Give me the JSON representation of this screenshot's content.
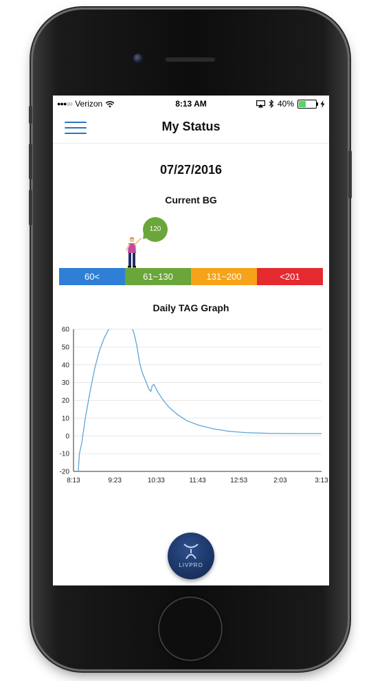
{
  "status_bar": {
    "signal_dots": "●●●○○",
    "carrier": "Verizon",
    "time": "8:13 AM",
    "battery_percent": "40%",
    "battery_level": 0.4
  },
  "nav": {
    "title": "My Status",
    "menu_icon": "hamburger-menu-icon"
  },
  "date": "07/27/2016",
  "current_bg": {
    "title": "Current BG",
    "value": "120",
    "ranges": [
      {
        "label": "60<",
        "color": "#2f7fd6"
      },
      {
        "label": "61~130",
        "color": "#6aa63a"
      },
      {
        "label": "131~200",
        "color": "#f6a31a"
      },
      {
        "label": "<201",
        "color": "#e52a30"
      }
    ]
  },
  "graph_title": "Daily TAG Graph",
  "chart_data": {
    "type": "line",
    "title": "Daily TAG Graph",
    "xlabel": "",
    "ylabel": "",
    "x_ticks": [
      "8:13",
      "9:23",
      "10:33",
      "11:43",
      "12:53",
      "2:03",
      "3:13"
    ],
    "y_ticks": [
      60,
      50,
      40,
      30,
      20,
      10,
      0,
      -10,
      -20
    ],
    "ylim": [
      -20,
      60
    ],
    "xlim_minutes": [
      0,
      420
    ],
    "grid": true,
    "line_color": "#5aa6d6",
    "series": [
      {
        "segments": [
          {
            "x": [
              8,
              10,
              14,
              20,
              28,
              36,
              44,
              52,
              58,
              60
            ],
            "y": [
              -20,
              -10,
              -4,
              10,
              25,
              38,
              48,
              55,
              59,
              60
            ]
          },
          {
            "x": [
              100,
              103,
              107,
              112,
              116,
              122,
              128,
              131,
              133,
              136,
              139,
              144,
              152,
              162,
              176,
              192,
              212,
              236,
              262,
              292,
              330,
              370,
              420
            ],
            "y": [
              60,
              57,
              51,
              41,
              36,
              31,
              26,
              25,
              28,
              29,
              27,
              24,
              20,
              16,
              12,
              8.5,
              6,
              4,
              2.6,
              1.8,
              1.4,
              1.3,
              1.3
            ]
          }
        ]
      }
    ]
  },
  "fab": {
    "label": "LIVPRO",
    "icon": "livpro-logo-icon"
  }
}
